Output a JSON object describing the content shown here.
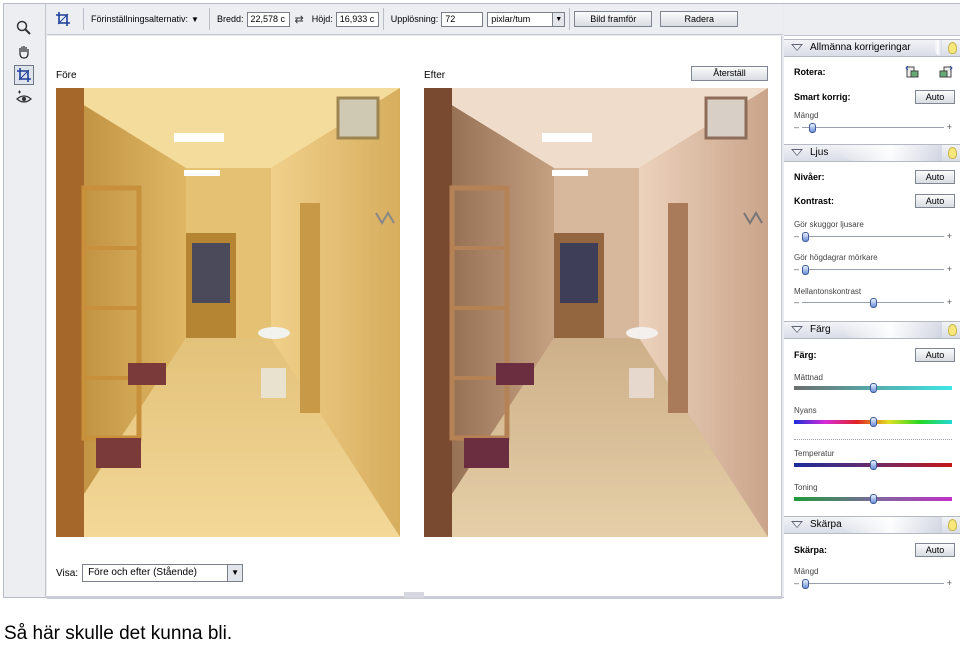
{
  "options_bar": {
    "preset_label": "Förinställningsalternativ:",
    "width_label": "Bredd:",
    "width_value": "22,578 c",
    "height_label": "Höjd:",
    "height_value": "16,933 c",
    "resolution_label": "Upplösning:",
    "resolution_value": "72",
    "unit_value": "pixlar/tum",
    "front_image_button": "Bild framför",
    "delete_button": "Radera"
  },
  "main": {
    "before_label": "Före",
    "after_label": "Efter",
    "reset_button": "Återställ",
    "view_label": "Visa:",
    "view_value": "Före och efter (Stående)"
  },
  "panel": {
    "general": {
      "title": "Allmänna korrigeringar",
      "rotate_label": "Rotera:",
      "smart_label": "Smart korrig:",
      "auto": "Auto",
      "amount_label": "Mängd",
      "amount_level": 0.05
    },
    "light": {
      "title": "Ljus",
      "levels_label": "Nivåer:",
      "contrast_label": "Kontrast:",
      "auto": "Auto",
      "shadows_label": "Gör skuggor ljusare",
      "shadows_level": 0.0,
      "highlights_label": "Gör högdagrar mörkare",
      "highlights_level": 0.0,
      "midtone_label": "Mellantonskontrast",
      "midtone_level": 0.5
    },
    "color": {
      "title": "Färg",
      "color_label": "Färg:",
      "auto": "Auto",
      "saturation_label": "Mättnad",
      "saturation_level": 0.5,
      "hue_label": "Nyans",
      "hue_level": 0.5,
      "temperature_label": "Temperatur",
      "temperature_level": 0.5,
      "tint_label": "Toning",
      "tint_level": 0.5
    },
    "sharpness": {
      "title": "Skärpa",
      "sharp_label": "Skärpa:",
      "auto": "Auto",
      "amount_label": "Mängd",
      "amount_level": 0.0
    }
  },
  "caption": "Så här skulle det kunna bli.",
  "colors": {
    "panel_header": "#d9dde6",
    "slider_knob": "#6b8fd6"
  }
}
